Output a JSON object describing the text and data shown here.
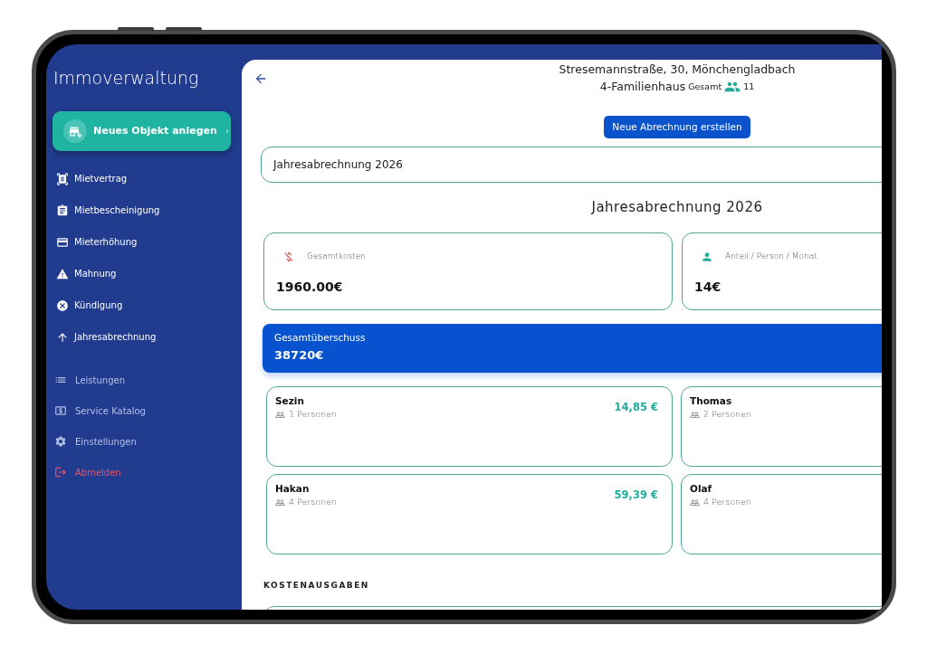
{
  "sidebar": {
    "title": "Immoverwaltung",
    "new_object_button": {
      "label": "Neues Objekt anlegen"
    },
    "document_items": [
      {
        "label": "Mietvertrag"
      },
      {
        "label": "Mietbescheinigung"
      },
      {
        "label": "Mieterhöhung"
      },
      {
        "label": "Mahnung"
      },
      {
        "label": "Kündigung"
      },
      {
        "label": "Jahresabrechnung"
      }
    ],
    "menu_items": [
      {
        "label": "Leistungen",
        "kind": "nav"
      },
      {
        "label": "Service Katalog",
        "kind": "nav"
      },
      {
        "label": "Einstellungen",
        "kind": "nav"
      },
      {
        "label": "Abmelden",
        "kind": "logout"
      }
    ]
  },
  "header": {
    "address": "Stresemannstraße, 30, Mönchengladbach",
    "building_type": "4-Familienhaus",
    "total_label": "Gesamt",
    "total_count": "11"
  },
  "new_statement_button": {
    "label": "Neue Abrechnung erstellen"
  },
  "statement_select": {
    "value": "Jahresabrechnung 2026"
  },
  "statement_title": "Jahresabrechnung 2026",
  "stats": [
    {
      "kind": "costs",
      "label": "Gesamtkosten",
      "value": "1960.00€"
    },
    {
      "kind": "share",
      "label": "Anteil / Person / Monat",
      "value": "14€"
    }
  ],
  "surplus": {
    "label": "Gesamtüberschuss",
    "value": "38720€"
  },
  "tenants": [
    {
      "name": "Sezin",
      "persons": "1 Personen",
      "amount": "14,85 €"
    },
    {
      "name": "Thomas",
      "persons": "2 Personen"
    },
    {
      "name": "Hakan",
      "persons": "4 Personen",
      "amount": "59,39 €"
    },
    {
      "name": "Olaf",
      "persons": "4 Personen"
    }
  ],
  "expenses": {
    "title": "KOSTENAUSGABEN"
  }
}
